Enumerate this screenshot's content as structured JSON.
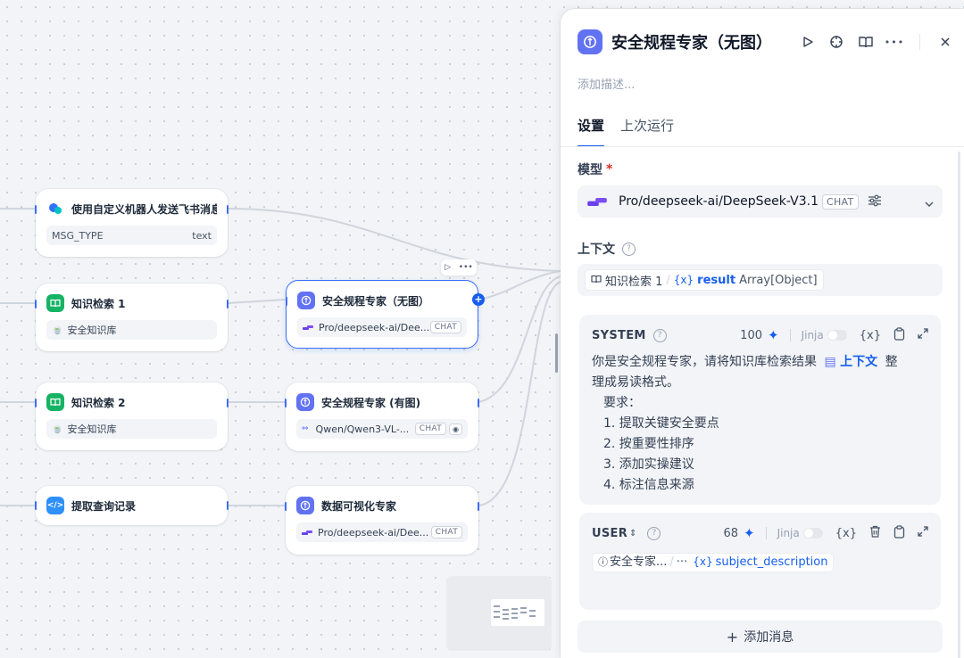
{
  "canvas": {
    "nodes": {
      "feishu": {
        "title": "使用自定义机器人发送飞书消息",
        "var_name": "MSG_TYPE",
        "var_type": "text"
      },
      "kb1": {
        "title": "知识检索 1",
        "kb": "安全知识库"
      },
      "kb2": {
        "title": "知识检索 2",
        "kb": "安全知识库"
      },
      "query": {
        "title": "提取查询记录"
      },
      "expert_noimg": {
        "title": "安全规程专家（无图）",
        "model": "Pro/deepseek-ai/Dee...",
        "tag": "CHAT"
      },
      "expert_img": {
        "title": "安全规程专家 (有图)",
        "model": "Qwen/Qwen3-VL-...",
        "tag": "CHAT"
      },
      "dataviz": {
        "title": "数据可视化专家",
        "model": "Pro/deepseek-ai/Dee...",
        "tag": "CHAT"
      }
    }
  },
  "panel": {
    "title": "安全规程专家（无图）",
    "description_placeholder": "添加描述...",
    "tabs": [
      "设置",
      "上次运行"
    ],
    "model_label": "模型",
    "model_required": "*",
    "model_name": "Pro/deepseek-ai/DeepSeek-V3.1",
    "model_tag": "CHAT",
    "context_label": "上下文",
    "context_var": {
      "node": "知识检索 1",
      "sep": "/",
      "var": "result",
      "type": "Array[Object]"
    },
    "system": {
      "role": "SYSTEM",
      "count": "100",
      "jinja": "Jinja",
      "line1_a": "你是安全规程专家，请将知识库检索结果",
      "line1_ref": "上下文",
      "line1_b": "整",
      "line2": "理成易读格式。",
      "req": "要求：",
      "items": [
        "1. 提取关键安全要点",
        "2. 按重要性排序",
        "3. 添加实操建议",
        "4. 标注信息来源"
      ]
    },
    "user": {
      "role": "USER",
      "count": "68",
      "jinja": "Jinja",
      "ref_node": "安全专家...",
      "ref_sep": "/",
      "ref_more": "···",
      "ref_var": "subject_description"
    },
    "add_message": "添加消息"
  }
}
